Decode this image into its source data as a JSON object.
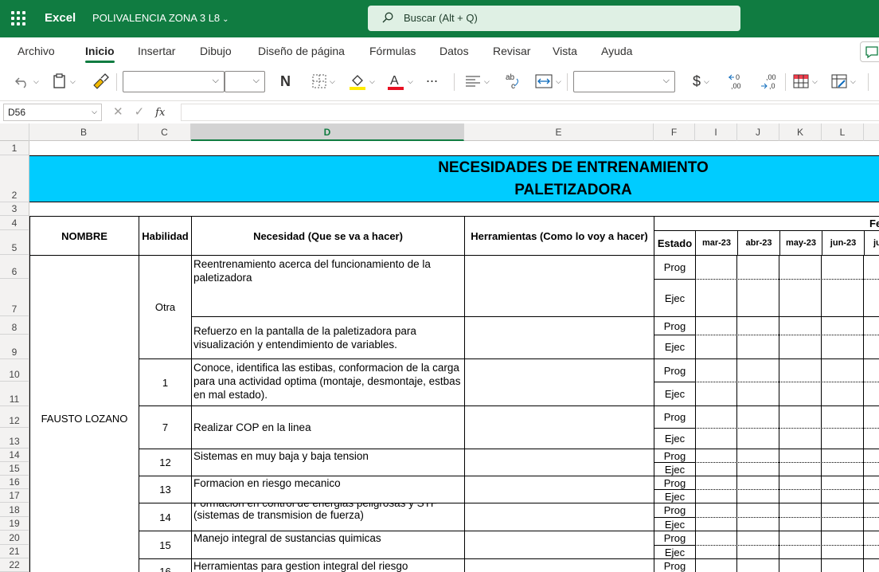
{
  "app": {
    "name": "Excel",
    "document": "POLIVALENCIA ZONA 3 L8"
  },
  "search": {
    "placeholder": "Buscar (Alt + Q)"
  },
  "menu": {
    "tabs": [
      "Archivo",
      "Inicio",
      "Insertar",
      "Dibujo",
      "Diseño de página",
      "Fórmulas",
      "Datos",
      "Revisar",
      "Vista",
      "Ayuda"
    ],
    "active": "Inicio"
  },
  "ribbon": {
    "bold_label": "N",
    "currency_label": "$",
    "more_label": "..."
  },
  "formula_bar": {
    "name_box": "D56",
    "fx": "fx"
  },
  "columns": [
    "B",
    "C",
    "D",
    "E",
    "F",
    "I",
    "J",
    "K",
    "L"
  ],
  "selected_column": "D",
  "rows": [
    "1",
    "2",
    "3",
    "4",
    "5",
    "6",
    "7",
    "8",
    "9",
    "10",
    "11",
    "12",
    "13",
    "14",
    "15",
    "16",
    "17",
    "18",
    "19",
    "20",
    "21",
    "22"
  ],
  "sheet": {
    "title_line1": "NECESIDADES DE ENTRENAMIENTO",
    "title_line2": "PALETIZADORA",
    "headers": {
      "nombre": "NOMBRE",
      "habilidad": "Habilidad",
      "necesidad": "Necesidad (Que se va a hacer)",
      "herramientas": "Herramientas (Como lo voy a hacer)",
      "estado": "Estado",
      "fecha_partial": "Fe",
      "months": [
        "mar-23",
        "abr-23",
        "may-23",
        "jun-23",
        "ju"
      ]
    },
    "person": "FAUSTO LOZANO",
    "estado_prog": "Prog",
    "estado_ejec": "Ejec",
    "entries": [
      {
        "habilidad": "Otra",
        "necesidad": "Reentrenamiento acerca del funcionamiento de la paletizadora"
      },
      {
        "habilidad": "",
        "necesidad": "Refuerzo en la pantalla de la paletizadora para visualización y entendimiento de variables."
      },
      {
        "habilidad": "1",
        "necesidad": "Conoce, identifica  las estibas, conformacion de la carga para una actividad optima (montaje, desmontaje, estbas en mal estado)."
      },
      {
        "habilidad": "7",
        "necesidad": "Realizar COP en la linea"
      },
      {
        "habilidad": "12",
        "necesidad": "Sistemas en muy baja y baja tension"
      },
      {
        "habilidad": "13",
        "necesidad": "Formacion en riesgo mecanico"
      },
      {
        "habilidad": "14",
        "necesidad": "Formacion en control de energias peligrosas y STF (sistemas de transmision de fuerza)"
      },
      {
        "habilidad": "15",
        "necesidad": "Manejo integral de sustancias quimicas"
      },
      {
        "habilidad": "16",
        "necesidad": "Herramientas para gestion integral del riesgo"
      }
    ]
  }
}
